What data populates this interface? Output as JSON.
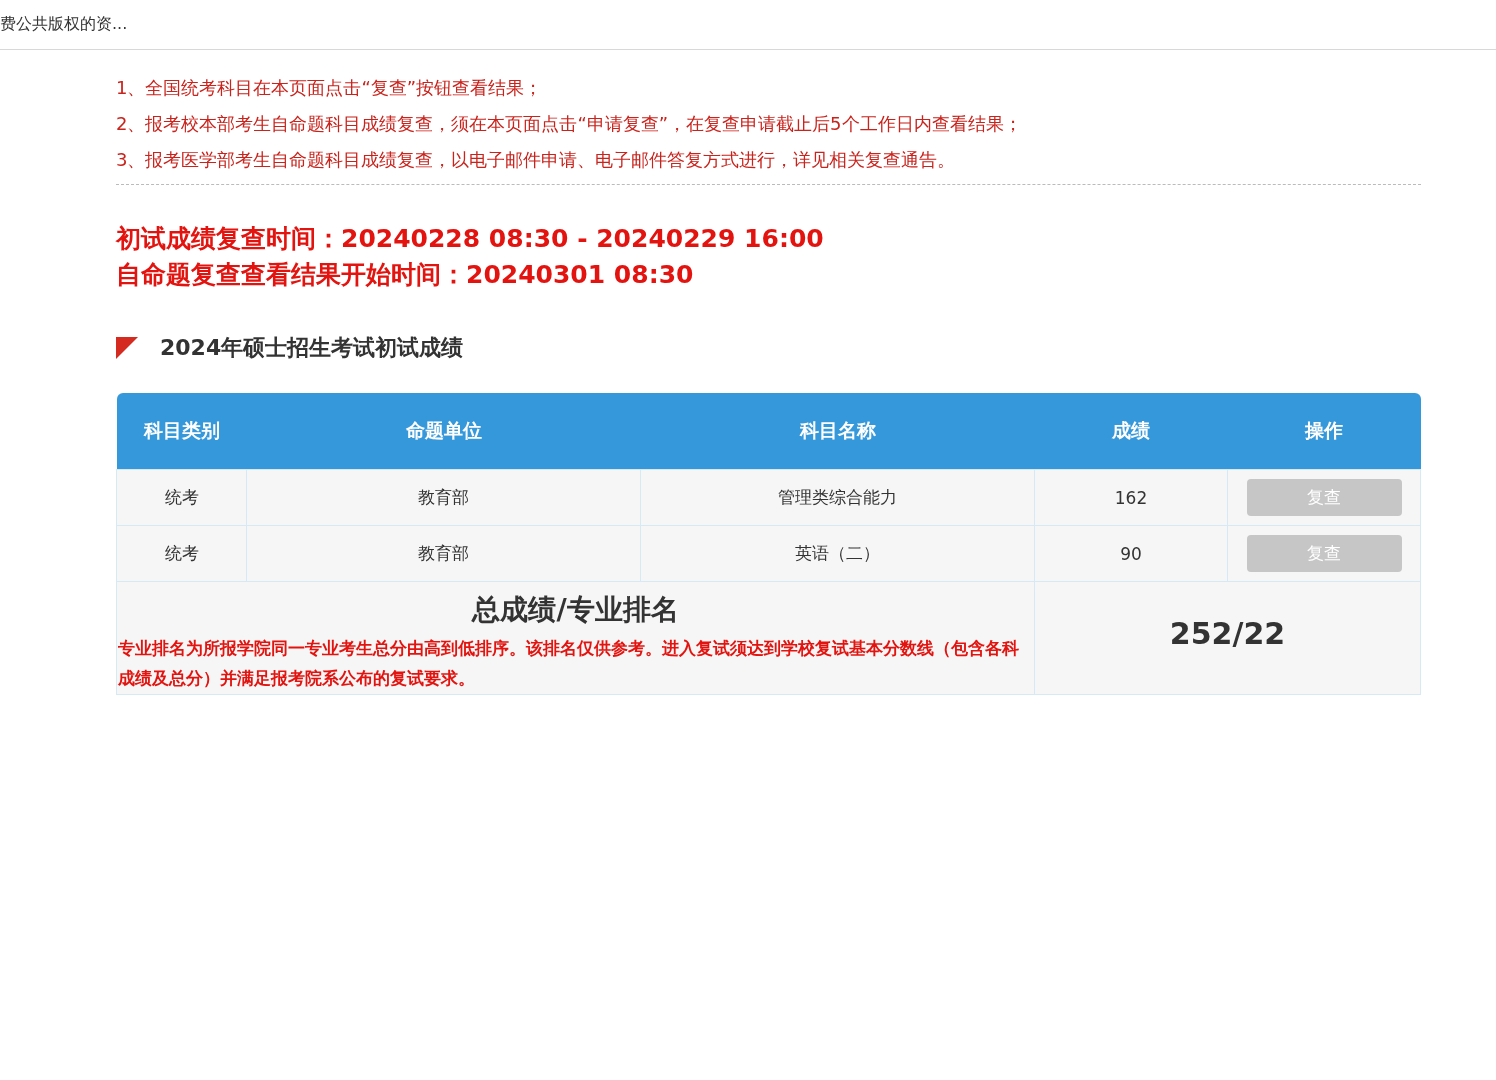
{
  "top_bar": {
    "title": "费公共版权的资..."
  },
  "notices": [
    "1、全国统考科目在本页面点击“复查”按钮查看结果；",
    "2、报考校本部考生自命题科目成绩复查，须在本页面点击“申请复查”，在复查申请截止后5个工作日内查看结果；",
    "3、报考医学部考生自命题科目成绩复查，以电子邮件申请、电子邮件答复方式进行，详见相关复查通告。"
  ],
  "times": [
    "初试成绩复查时间：20240228 08:30 - 20240229 16:00",
    "自命题复查查看结果开始时间：20240301 08:30"
  ],
  "section_title": "2024年硕士招生考试初试成绩",
  "table": {
    "columns": [
      "科目类别",
      "命题单位",
      "科目名称",
      "成绩",
      "操作"
    ],
    "rows": [
      {
        "category": "统考",
        "unit": "教育部",
        "subject": "管理类综合能力",
        "score": "162",
        "action": "复查",
        "disabled": true
      },
      {
        "category": "统考",
        "unit": "教育部",
        "subject": "英语（二）",
        "score": "90",
        "action": "复查",
        "disabled": true
      }
    ],
    "total": {
      "label": "总成绩/专业排名",
      "note": "专业排名为所报学院同一专业考生总分由高到低排序。该排名仅供参考。进入复试须达到学校复试基本分数线（包含各科成绩及总分）并满足报考院系公布的复试要求。",
      "value": "252/22"
    }
  }
}
